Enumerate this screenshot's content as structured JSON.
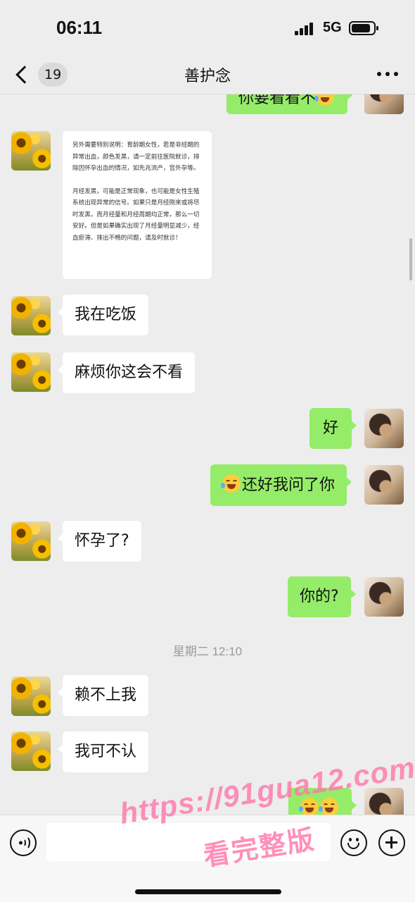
{
  "status_bar": {
    "time": "06:11",
    "network": "5G"
  },
  "nav": {
    "unread_count": "19",
    "title": "善护念"
  },
  "messages": {
    "prev_out_partial": "你要看看不",
    "card_paragraph_1": "另外需要特别说明：育龄期女性，若是非经期的异常出血，颜色发黑，请一定前往医院就诊，排除因怀孕出血的情况，如先兆流产，宫外孕等。",
    "card_paragraph_2": "月经发黑，可能是正常现象，也可能是女性生殖系统出现异常的信号。如果只是月经刚来或将尽时发黑，而月经量和月经周期均正常，那么一切安好。但是如果确实出现了月经量明显减少，经血瘀滞、排出不畅的问题，请及时就诊！",
    "m1": "我在吃饭",
    "m2": "麻烦你这会不看",
    "m3": "好",
    "m4": "还好我问了你",
    "m5": "怀孕了?",
    "m6": "你的?",
    "timestamp": "星期二 12:10",
    "m7": "赖不上我",
    "m8": "我可不认"
  },
  "input": {
    "placeholder": ""
  },
  "watermark": {
    "line1": "https://91gua12.com",
    "line2": "看完整版"
  },
  "icons": {
    "back": "chevron-left-icon",
    "more": "more-dots-icon",
    "voice": "voice-icon",
    "emoji": "emoji-icon",
    "plus": "plus-icon",
    "emoji_in_text": "laugh-cry-emoji-icon"
  },
  "colors": {
    "outgoing_bubble": "#95ec69",
    "incoming_bubble": "#ffffff",
    "background": "#ededed"
  }
}
